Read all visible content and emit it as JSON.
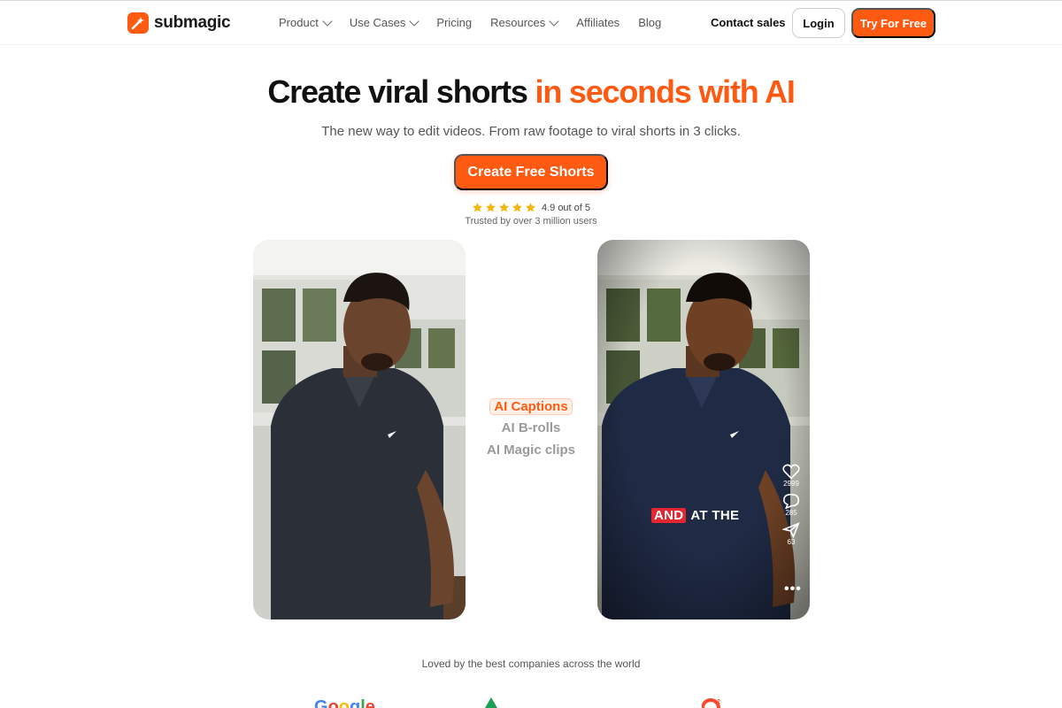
{
  "brand": {
    "name": "submagic",
    "accent": "#ff5a12"
  },
  "nav": {
    "links": [
      {
        "label": "Product",
        "dropdown": true
      },
      {
        "label": "Use Cases",
        "dropdown": true
      },
      {
        "label": "Pricing",
        "dropdown": false
      },
      {
        "label": "Resources",
        "dropdown": true
      },
      {
        "label": "Affiliates",
        "dropdown": false
      },
      {
        "label": "Blog",
        "dropdown": false
      }
    ],
    "contact": "Contact sales",
    "login": "Login",
    "try": "Try For Free"
  },
  "hero": {
    "headline_main": "Create viral shorts ",
    "headline_accent": "in seconds with AI",
    "subline": "The new way to edit videos. From raw footage to viral shorts in 3 clicks.",
    "cta": "Create Free Shorts",
    "rating_text": "4.9 out of 5",
    "rating_stars": 5,
    "trusted": "Trusted by over 3 million users"
  },
  "features": {
    "items": [
      "AI Captions",
      "AI B-rolls",
      "AI Magic clips"
    ],
    "active_index": 0
  },
  "preview": {
    "caption_highlight": "AND",
    "caption_rest": "AT THE",
    "likes": "2999",
    "comments": "285",
    "shares": "63"
  },
  "companies": {
    "heading": "Loved by the best companies across the world"
  }
}
